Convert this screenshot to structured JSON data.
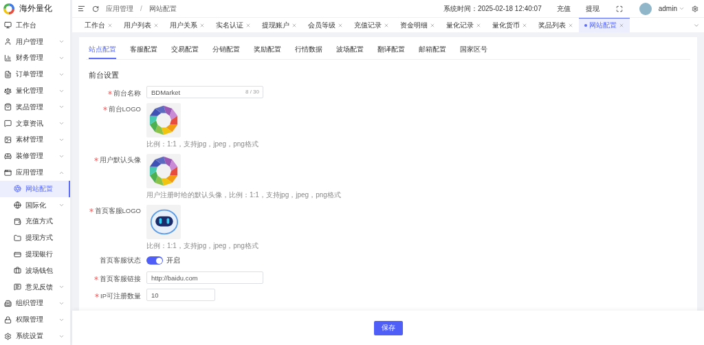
{
  "brand": {
    "name": "海外量化"
  },
  "header": {
    "breadcrumb": [
      "应用管理",
      "网站配置"
    ],
    "breadcrumb_separator": "/",
    "system_time": "系统时间：2025-02-18 12:40:07",
    "links": [
      "充值",
      "提现"
    ],
    "user": "admin"
  },
  "sidebar": {
    "items": [
      {
        "label": "工作台",
        "selected": false
      },
      {
        "label": "用户管理",
        "selected": false,
        "expanded": false
      },
      {
        "label": "财务管理",
        "selected": false,
        "expanded": false
      },
      {
        "label": "订单管理",
        "selected": false,
        "expanded": false
      },
      {
        "label": "量化管理",
        "selected": false,
        "expanded": false
      },
      {
        "label": "奖品管理",
        "selected": false,
        "expanded": false
      },
      {
        "label": "文章资讯",
        "selected": false,
        "expanded": false
      },
      {
        "label": "素材管理",
        "selected": false,
        "expanded": false
      },
      {
        "label": "装修管理",
        "selected": false,
        "expanded": false
      },
      {
        "label": "应用管理",
        "selected": false,
        "expanded": true,
        "children": [
          {
            "label": "网站配置",
            "selected": true
          },
          {
            "label": "国际化",
            "selected": false,
            "expanded": false
          },
          {
            "label": "充值方式",
            "selected": false
          },
          {
            "label": "提现方式",
            "selected": false
          },
          {
            "label": "提现银行",
            "selected": false
          },
          {
            "label": "波场钱包",
            "selected": false
          },
          {
            "label": "意见反馈",
            "selected": false,
            "expanded": false
          }
        ]
      },
      {
        "label": "组织管理",
        "selected": false,
        "expanded": false
      },
      {
        "label": "权限管理",
        "selected": false,
        "expanded": false
      },
      {
        "label": "系统设置",
        "selected": false,
        "expanded": false
      }
    ]
  },
  "tabs": [
    {
      "label": "工作台",
      "selected": false
    },
    {
      "label": "用户列表",
      "selected": false
    },
    {
      "label": "用户关系",
      "selected": false
    },
    {
      "label": "实名认证",
      "selected": false
    },
    {
      "label": "提现账户",
      "selected": false
    },
    {
      "label": "会员等级",
      "selected": false
    },
    {
      "label": "充值记录",
      "selected": false
    },
    {
      "label": "资金明细",
      "selected": false
    },
    {
      "label": "量化记录",
      "selected": false
    },
    {
      "label": "量化货币",
      "selected": false
    },
    {
      "label": "奖品列表",
      "selected": false
    },
    {
      "label": "网站配置",
      "selected": true
    }
  ],
  "settings_tabs": [
    {
      "label": "站点配置",
      "selected": true
    },
    {
      "label": "客服配置",
      "selected": false
    },
    {
      "label": "交易配置",
      "selected": false
    },
    {
      "label": "分销配置",
      "selected": false
    },
    {
      "label": "奖励配置",
      "selected": false
    },
    {
      "label": "行情数据",
      "selected": false
    },
    {
      "label": "波场配置",
      "selected": false
    },
    {
      "label": "翻译配置",
      "selected": false
    },
    {
      "label": "邮箱配置",
      "selected": false
    },
    {
      "label": "国家区号",
      "selected": false
    }
  ],
  "section_title": "前台设置",
  "fields": [
    {
      "kind": "text",
      "label": "前台名称",
      "required": true,
      "value": "BDMarket",
      "counter": "8 / 30"
    },
    {
      "kind": "image",
      "label": "前台LOGO",
      "required": true,
      "hint": "比例：1:1，支持jpg，jpeg，png格式"
    },
    {
      "kind": "image",
      "label": "用户默认头像",
      "required": true,
      "hint": "用户注册时给的默认头像，比例：1:1，支持jpg，jpeg，png格式"
    },
    {
      "kind": "image",
      "label": "首页客服LOGO",
      "required": true,
      "hint": "比例：1:1，支持jpg，jpeg，png格式"
    },
    {
      "kind": "switch",
      "label": "首页客服状态",
      "required": false,
      "on": true,
      "text": "开启"
    },
    {
      "kind": "text",
      "label": "首页客服链接",
      "required": true,
      "value": "http://baidu.com"
    },
    {
      "kind": "text",
      "label": "IP可注册数量",
      "required": true,
      "value": "10"
    }
  ],
  "save_button": "保存"
}
